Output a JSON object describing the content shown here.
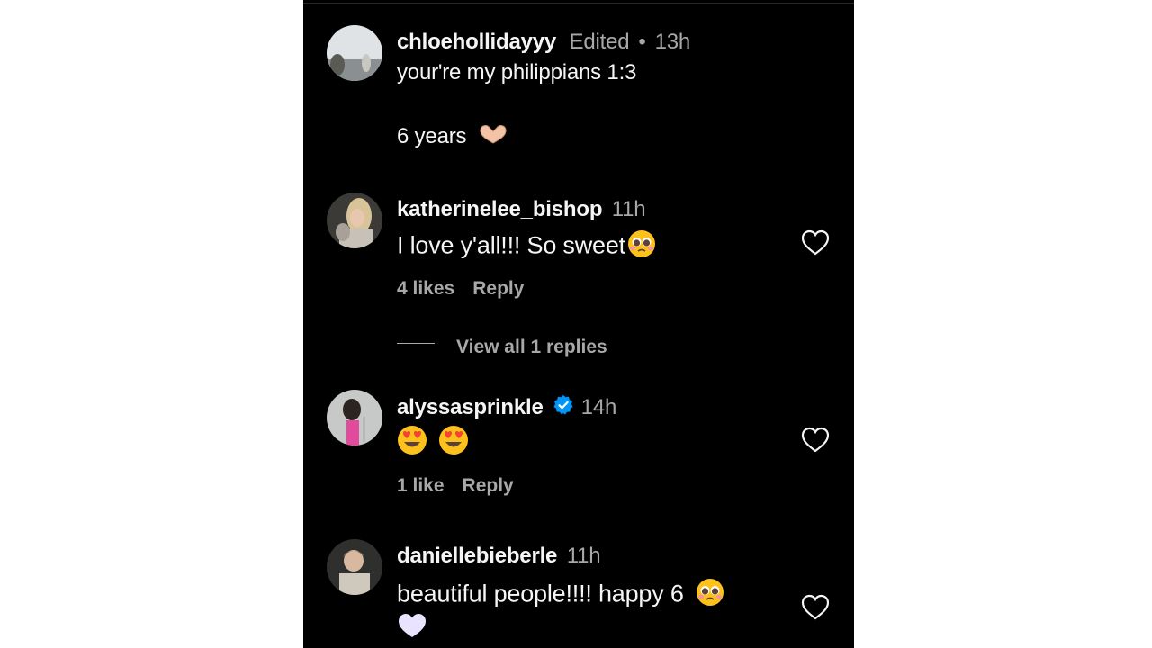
{
  "comments": [
    {
      "username": "chloehollidayyy",
      "edited": "Edited",
      "time": "13h",
      "text_line1": "your're my philippians 1:3",
      "text_line2": "6 years",
      "icon": "heart-hands-emoji"
    },
    {
      "username": "katherinelee_bishop",
      "time": "11h",
      "text": "I love y'all!!! So sweet",
      "icon": "pleading-face-emoji",
      "likes": "4 likes",
      "reply": "Reply",
      "view_replies": "View all 1 replies"
    },
    {
      "username": "alyssasprinkle",
      "verified": true,
      "time": "14h",
      "icon": "heart-eyes-emoji",
      "likes": "1 like",
      "reply": "Reply"
    },
    {
      "username": "daniellebieberle",
      "time": "11h",
      "text": "beautiful people!!!! happy 6",
      "icon": "pleading-face-emoji",
      "icon2": "white-heart-emoji"
    }
  ],
  "colors": {
    "background": "#000000",
    "text": "#f5f5f5",
    "secondary": "#a8a8a8",
    "verified": "#0095f6"
  }
}
